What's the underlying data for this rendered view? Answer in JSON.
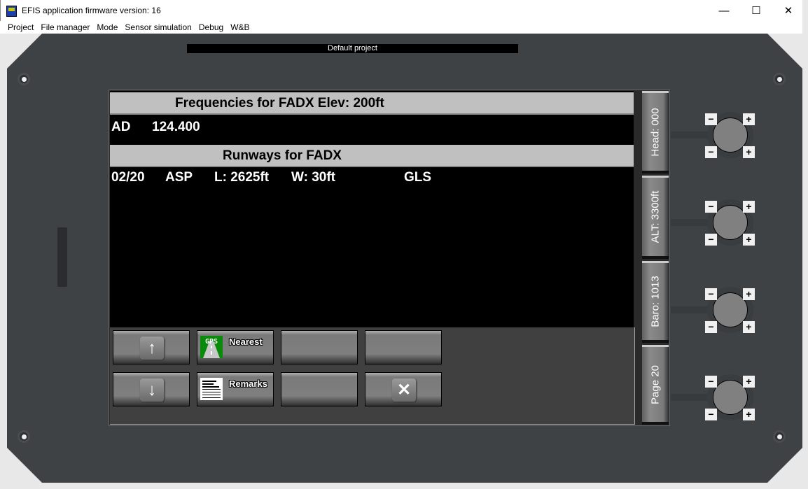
{
  "window": {
    "title": "EFIS application firmware version: 16",
    "controls": [
      "—",
      "☐",
      "✕"
    ]
  },
  "menu": [
    "Project",
    "File manager",
    "Mode",
    "Sensor simulation",
    "Debug",
    "W&B"
  ],
  "project_name": "Default project",
  "frequencies": {
    "header": "Frequencies for FADX Elev: 200ft",
    "rows": [
      {
        "type": "AD",
        "freq": "124.400"
      }
    ]
  },
  "runways": {
    "header": "Runways for FADX",
    "rows": [
      {
        "designator": "02/20",
        "surface": "ASP",
        "length": "L: 2625ft",
        "width": "W: 30ft",
        "lights": "GLS"
      }
    ]
  },
  "buttons": {
    "up": "↑",
    "down": "↓",
    "nearest": "Nearest",
    "gps_icon_text": "GPS",
    "remarks": "Remarks",
    "close": "✕"
  },
  "side_tabs": [
    "Head: 000",
    "ALT: 3300ft",
    "Baro: 1013",
    "Page 20"
  ],
  "knob": {
    "minus": "−",
    "plus": "+"
  }
}
